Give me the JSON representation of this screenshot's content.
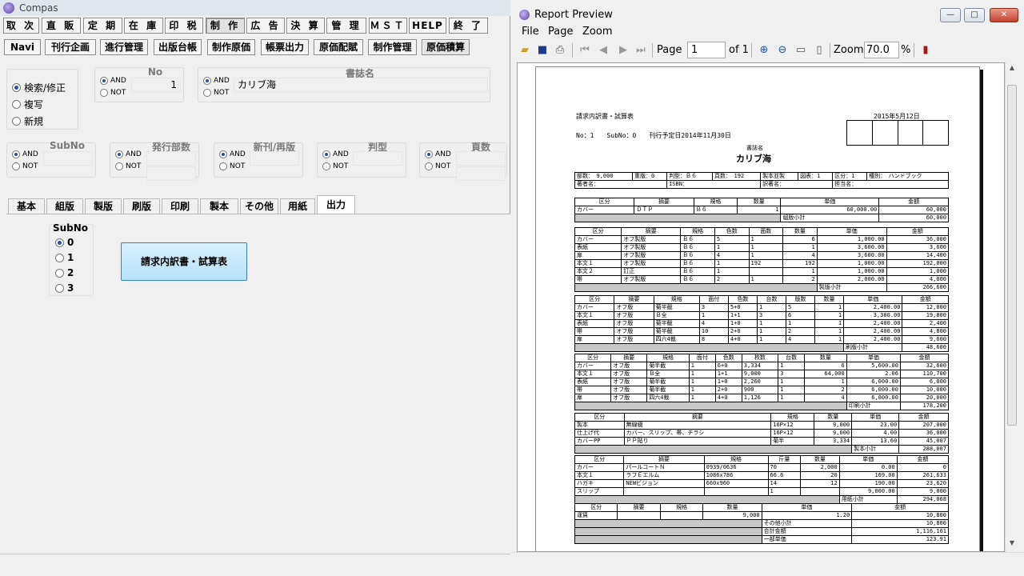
{
  "left": {
    "title": "Compas",
    "menu": [
      "取 次",
      "直 販",
      "定 期",
      "在 庫",
      "印 税",
      "制 作",
      "広 告",
      "決 算",
      "管 理",
      "ＭＳＴ",
      "HELP",
      "終 了"
    ],
    "submenu": [
      "Navi",
      "刊行企画",
      "進行管理",
      "出版台帳",
      "制作原価",
      "帳票出力",
      "原価配賦",
      "制作管理",
      "原価積算"
    ],
    "mode": [
      "検索/修正",
      "複写",
      "新規"
    ],
    "and_label": "AND",
    "not_label": "NOT",
    "no_label": "No",
    "no_value": "1",
    "title_label": "書誌名",
    "title_value": "カリブ海",
    "subno_label": "SubNo",
    "dept_label": "発行部数",
    "reprint_label": "新刊/再版",
    "format_label": "判型",
    "pages_label": "頁数",
    "tabs": [
      "基本",
      "組版",
      "製版",
      "刷版",
      "印刷",
      "製本",
      "その他",
      "用紙",
      "出力"
    ],
    "subno_box_label": "SubNo",
    "subno_options": [
      "0",
      "1",
      "2",
      "3"
    ],
    "report_button": "請求内訳書・試算表"
  },
  "right": {
    "title": "Report Preview",
    "menu": [
      "File",
      "Page",
      "Zoom"
    ],
    "page_label": "Page",
    "page_value": "1",
    "of_label": "of 1",
    "zoom_label": "Zoom",
    "zoom_value": "70.0",
    "percent": "%",
    "report": {
      "heading": "請求内訳書・試算表",
      "date": "2015年5月12日",
      "no_line": "No：1　　SubNo：0　　刊行予定日2014年11月30日",
      "book_label": "書誌名",
      "book_name": "カリブ海",
      "spec": [
        "部数：　9,000",
        "重版：0",
        "判型：Ｂ６",
        "頁数：　192",
        "製本並製",
        "図表：1",
        "区分：1",
        "種別：　ハンドブック"
      ],
      "authors": [
        "著者名：",
        "ISBN：",
        "訳著名：",
        "担当名："
      ],
      "s1_headers": [
        "区分",
        "摘要",
        "規格",
        "数量",
        "単価",
        "金額"
      ],
      "s1_rows": [
        [
          "カバー",
          "ＤＴＰ",
          "Ｂ６",
          "1",
          "60,000.00",
          "60,000"
        ]
      ],
      "s1_total": [
        "組版小計",
        "60,000"
      ],
      "s2_headers": [
        "区分",
        "摘要",
        "規格",
        "色数",
        "面数",
        "数量",
        "単価",
        "金額"
      ],
      "s2_rows": [
        [
          "カバー",
          "オフ製版",
          "Ｂ６",
          "5",
          "1",
          "6",
          "1,000.00",
          "36,000"
        ],
        [
          "表紙",
          "オフ製版",
          "Ｂ６",
          "1",
          "1",
          "1",
          "3,600.00",
          "3,600"
        ],
        [
          "扉",
          "オフ製版",
          "Ｂ６",
          "4",
          "1",
          "4",
          "3,600.00",
          "14,400"
        ],
        [
          "本文１",
          "オフ製版",
          "Ｂ６",
          "1",
          "192",
          "192",
          "1,000.00",
          "192,000"
        ],
        [
          "本文２",
          "訂正",
          "Ｂ６",
          "1",
          "",
          "1",
          "1,000.00",
          "1,000"
        ],
        [
          "帯",
          "オフ製版",
          "Ｂ６",
          "2",
          "1",
          "2",
          "2,000.00",
          "4,000"
        ]
      ],
      "s2_total": [
        "製版小計",
        "266,600"
      ],
      "s3_headers": [
        "区分",
        "摘要",
        "規格",
        "面付",
        "色数",
        "台数",
        "版数",
        "数量",
        "単価",
        "金額"
      ],
      "s3_rows": [
        [
          "カバー",
          "オフ版",
          "菊半截",
          "3",
          "5+0",
          "1",
          "5",
          "1",
          "2,400.00",
          "12,000"
        ],
        [
          "本文１",
          "オフ版",
          "Ｂ全",
          "1",
          "1+1",
          "3",
          "6",
          "1",
          "3,300.00",
          "19,800"
        ],
        [
          "表紙",
          "オフ版",
          "菊半截",
          "4",
          "1+0",
          "1",
          "1",
          "1",
          "2,400.00",
          "2,400"
        ],
        [
          "帯",
          "オフ版",
          "菊半截",
          "10",
          "2+0",
          "1",
          "2",
          "1",
          "2,400.00",
          "4,800"
        ],
        [
          "扉",
          "オフ版",
          "四六4裁",
          "8",
          "4+0",
          "1",
          "4",
          "1",
          "2,400.00",
          "9,600"
        ]
      ],
      "s3_total": [
        "刷版小計",
        "48,600"
      ],
      "s4_headers": [
        "区分",
        "摘要",
        "規格",
        "面付",
        "色数",
        "枚数",
        "台数",
        "数量",
        "単価",
        "金額"
      ],
      "s4_rows": [
        [
          "カバー",
          "オフ版",
          "菊半截",
          "1",
          "6+0",
          "3,334",
          "1",
          "6",
          "5,600.00",
          "32,600"
        ],
        [
          "本文１",
          "オフ版",
          "Ｂ全",
          "1",
          "1+1",
          "9,000",
          "3",
          "64,000",
          "2.06",
          "110,700"
        ],
        [
          "表紙",
          "オフ版",
          "菊半截",
          "1",
          "1+0",
          "2,260",
          "1",
          "1",
          "6,000.00",
          "6,000"
        ],
        [
          "帯",
          "オフ版",
          "菊半截",
          "1",
          "2+0",
          "900",
          "1",
          "2",
          "6,000.00",
          "10,000"
        ],
        [
          "扉",
          "オフ版",
          "四六4裁",
          "1",
          "4+0",
          "1,126",
          "1",
          "4",
          "6,000.00",
          "20,000"
        ]
      ],
      "s4_total": [
        "印刷小計",
        "178,200"
      ],
      "s5_headers": [
        "区分",
        "摘要",
        "規格",
        "数量",
        "単価",
        "金額"
      ],
      "s5_rows": [
        [
          "製本",
          "無線綴",
          "16P×12",
          "9,000",
          "23.00",
          "207,000"
        ],
        [
          "仕上げ代",
          "カバー、スリップ、帯、チラシ",
          "16P×12",
          "9,000",
          "4.00",
          "36,000"
        ],
        [
          "カバーPP",
          "ＰＰ貼り",
          "菊半",
          "3,334",
          "13.60",
          "45,007"
        ]
      ],
      "s5_total": [
        "製本小計",
        "288,007"
      ],
      "s6_headers": [
        "区分",
        "摘要",
        "規格",
        "斤量",
        "数量",
        "単価",
        "金額"
      ],
      "s6_rows": [
        [
          "カバー",
          "パールコートＮ",
          "0939/0636",
          "70",
          "2,000",
          "0.00",
          "0"
        ],
        [
          "本文１",
          "ラフＥエルム",
          "1086x786",
          "66.6",
          "20",
          "169.00",
          "261,633"
        ],
        [
          "ハガキ",
          "NEWビジョン",
          "660x960",
          "14",
          "12",
          "190.00",
          "23,620"
        ],
        [
          "スリップ",
          "",
          "",
          "1",
          "",
          "9,000.00",
          "9,000"
        ]
      ],
      "s6_total": [
        "用紙小計",
        "294,068"
      ],
      "s7_headers": [
        "区分",
        "摘要",
        "規格",
        "数量",
        "単価",
        "金額"
      ],
      "s7_rows": [
        [
          "運賃",
          "",
          "",
          "9,000",
          "1.20",
          "10,800"
        ]
      ],
      "s7_totals": [
        [
          "その他小計",
          "10,800"
        ],
        [
          "合計金額",
          "1,116,161"
        ],
        [
          "一部単価",
          "123.91"
        ]
      ]
    }
  }
}
